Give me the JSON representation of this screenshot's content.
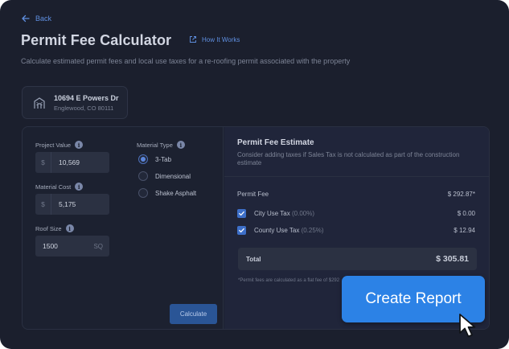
{
  "nav": {
    "back_label": "Back"
  },
  "header": {
    "title": "Permit Fee Calculator",
    "how_it_works": "How It Works",
    "subtitle": "Calculate estimated permit fees and local use taxes for a re-roofing permit associated with the property"
  },
  "address": {
    "line1": "10694 E Powers Dr",
    "line2": "Englewood, CO 80111"
  },
  "form": {
    "project_value": {
      "label": "Project Value",
      "prefix": "$",
      "value": "10,569"
    },
    "material_cost": {
      "label": "Material Cost",
      "prefix": "$",
      "value": "5,175"
    },
    "roof_size": {
      "label": "Roof Size",
      "value": "1500",
      "suffix": "SQ"
    },
    "material_type": {
      "label": "Material Type",
      "options": [
        "3-Tab",
        "Dimensional",
        "Shake Asphalt"
      ],
      "selected": "3-Tab"
    },
    "calculate_label": "Calculate"
  },
  "estimate": {
    "title": "Permit Fee Estimate",
    "subtitle": "Consider adding taxes if Sales Tax is not calculated as part of the construction estimate",
    "permit_fee": {
      "label": "Permit Fee",
      "value": "$ 292.87*"
    },
    "city_tax": {
      "label": "City Use Tax",
      "rate": "(0.00%)",
      "value": "$ 0.00",
      "checked": true
    },
    "county_tax": {
      "label": "County Use Tax",
      "rate": "(0.25%)",
      "value": "$ 12.94",
      "checked": true
    },
    "total": {
      "label": "Total",
      "value": "$ 305.81"
    },
    "footnote": "*Permit fees are calculated as a flat fee of $292"
  },
  "cta": {
    "label": "Create Report"
  },
  "colors": {
    "accent": "#2c82e6",
    "background": "#1b1f2d",
    "link": "#5f8fe0"
  }
}
